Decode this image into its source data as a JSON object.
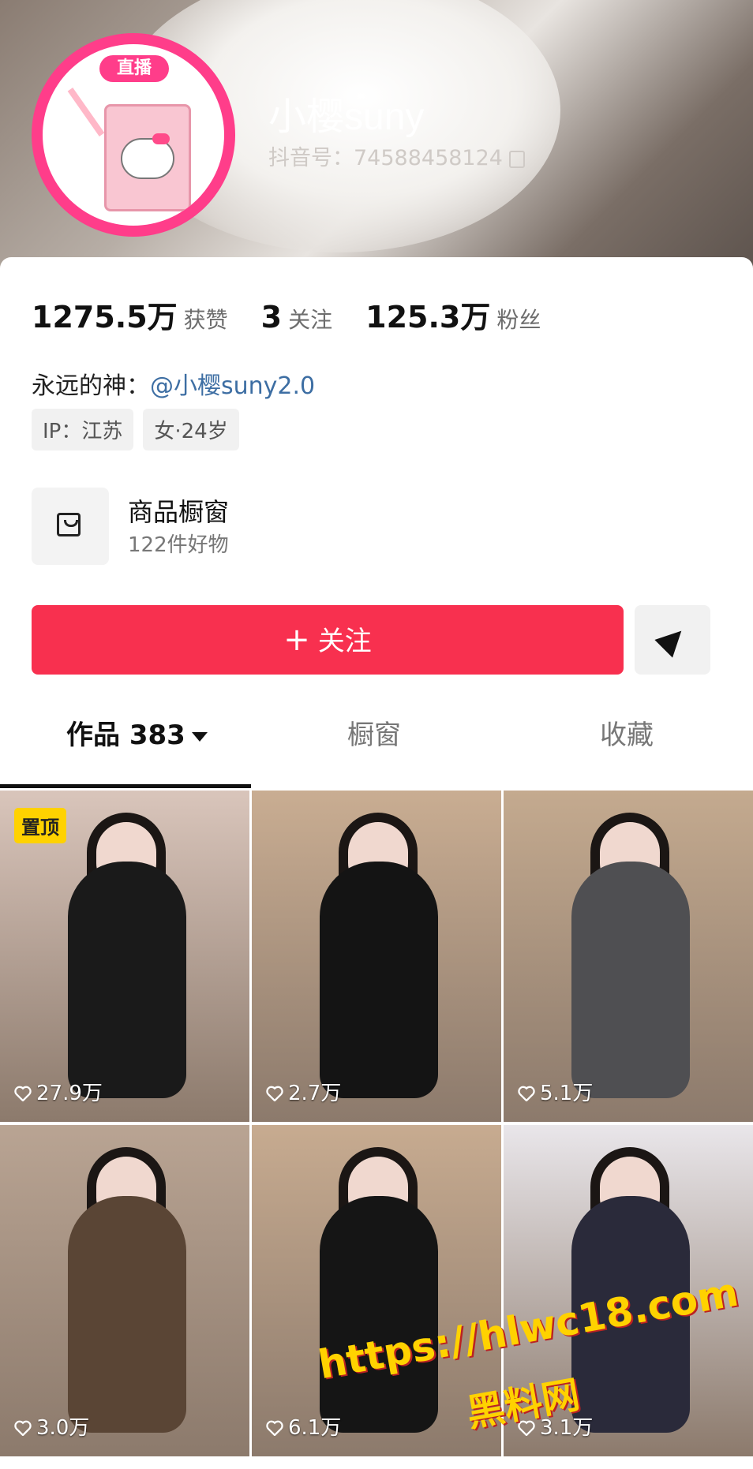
{
  "header": {
    "live_badge": "直播",
    "username": "小樱suny",
    "douyin_id": "抖音号：74588458124"
  },
  "stats": {
    "likes_num": "1275.5万",
    "likes_label": "获赞",
    "following_num": "3",
    "following_label": "关注",
    "fans_num": "125.3万",
    "fans_label": "粉丝"
  },
  "bio": {
    "prefix": "永远的神：",
    "mention": "@小樱suny2.0"
  },
  "tags": [
    "IP：江苏",
    "女·24岁"
  ],
  "shop": {
    "title": "商品橱窗",
    "subtitle": "122件好物"
  },
  "follow_button": {
    "icon": "+",
    "label": "关注"
  },
  "tabs": {
    "works": "作品 383",
    "showcase": "橱窗",
    "favorites": "收藏"
  },
  "videos": [
    {
      "pinned": "置顶",
      "likes": "27.9万",
      "bg": "#d9c5bb",
      "outfit": "#1a1a1a"
    },
    {
      "likes": "2.7万",
      "bg": "#c9ad92",
      "outfit": "#141414"
    },
    {
      "likes": "5.1万",
      "bg": "#c4aa8f",
      "outfit": "#4f4f52"
    },
    {
      "likes": "3.0万",
      "bg": "#b9a493",
      "outfit": "#5a4535"
    },
    {
      "likes": "6.1万",
      "bg": "#c7ab90",
      "outfit": "#151515"
    },
    {
      "likes": "3.1万",
      "bg": "#e9e6ea",
      "outfit": "#2a2a3a"
    }
  ],
  "watermark": {
    "line1": "https://hlwc18.com",
    "line2": "黑料网"
  },
  "colors": {
    "follow_red": "#f8304f",
    "live_pink": "#ff3d8a",
    "pinned_yellow": "#ffd200"
  }
}
